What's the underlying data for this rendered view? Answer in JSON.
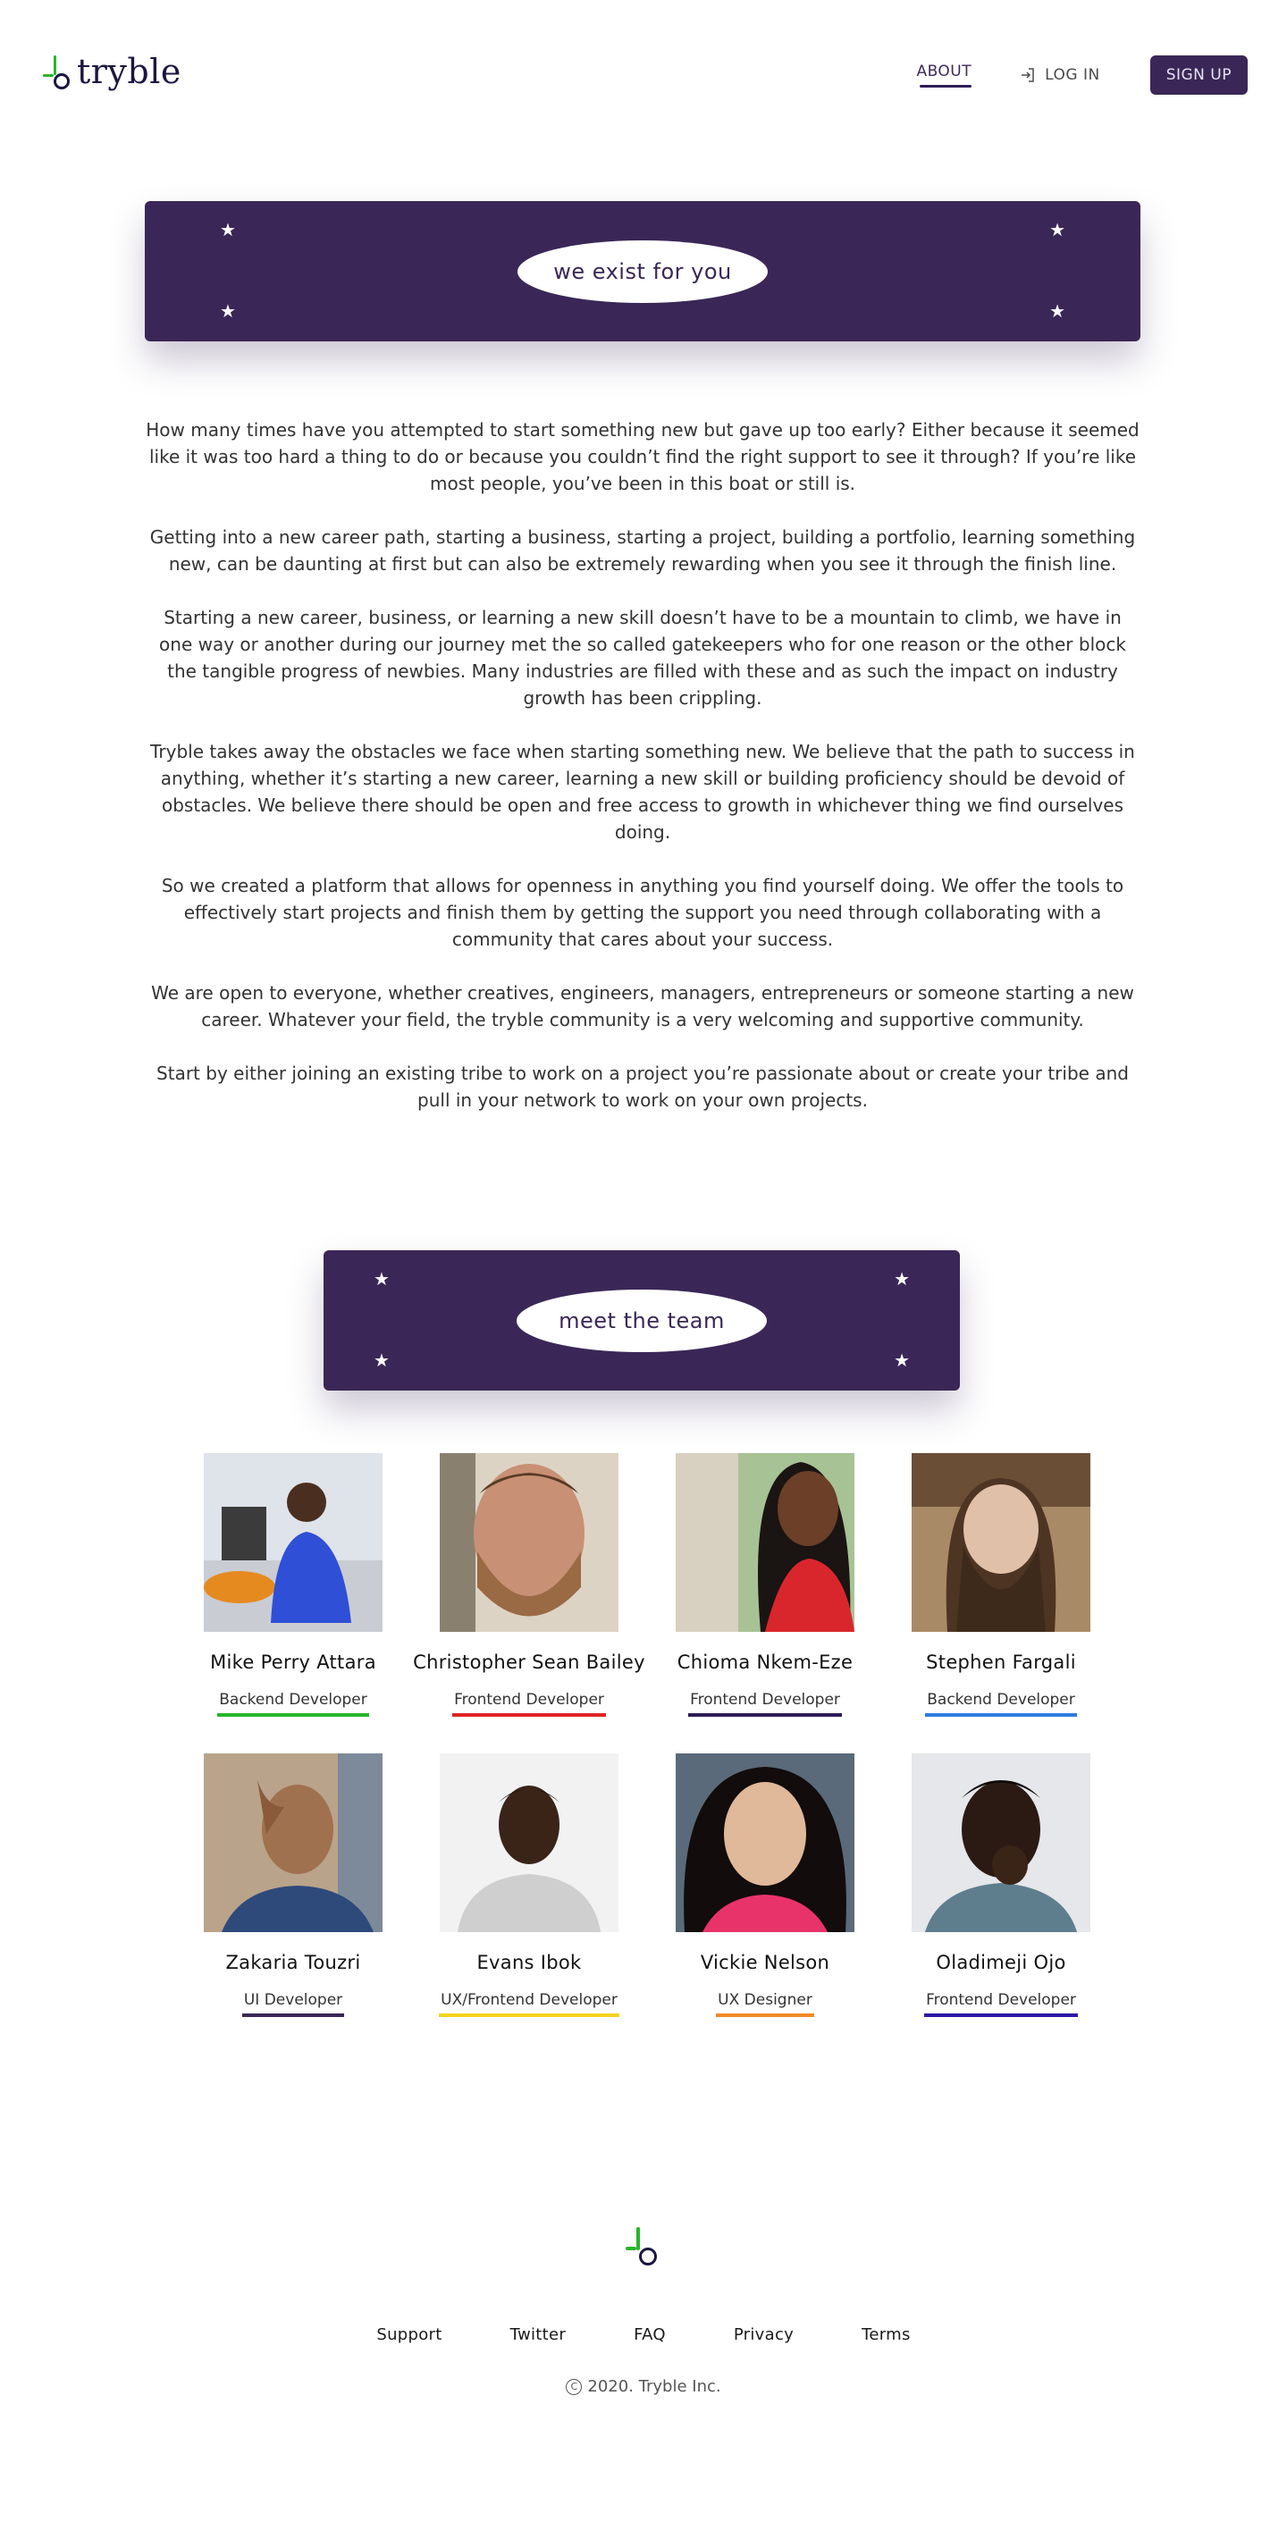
{
  "header": {
    "logo_text": "tryble",
    "nav": {
      "about": "ABOUT",
      "login": "LOG IN",
      "signup": "SIGN UP"
    }
  },
  "about_banner": {
    "title": "we exist for you"
  },
  "about": {
    "paragraphs": [
      "How many times have you attempted to start something new but gave up too early? Either because it seemed like it was too hard a thing to do or because you couldn’t find the right support to see it through? If you’re like most people, you’ve been in this boat or still is.",
      "Getting into a new career path, starting a business, starting a project, building a portfolio, learning something new, can be daunting at first but can also be extremely rewarding when you see it through the finish line.",
      "Starting a new career, business, or learning a new skill doesn’t have to be a mountain to climb, we have in one way or another during our journey met the so called gatekeepers who for one reason or the other block the tangible progress of newbies. Many industries are filled with these and as such the impact on industry growth has been crippling.",
      "Tryble takes away the obstacles we face when starting something new. We believe that the path to success in anything, whether it’s starting a new career, learning a new skill or building proficiency should be devoid of obstacles. We believe there should be open and free access to growth in whichever thing we find ourselves doing.",
      "So we created a platform that allows for openness in anything you find yourself doing. We offer the tools to effectively start projects and finish them by getting the support you need through collaborating with a community that cares about your success.",
      "We are open to everyone, whether creatives, engineers, managers, entrepreneurs or someone starting a new career. Whatever your field, the tryble community is a very welcoming and supportive community.",
      "Start by either joining an existing tribe to work on a project you’re passionate about or create your tribe and pull in your network to work on your own projects."
    ]
  },
  "team_banner": {
    "title": "meet the team"
  },
  "team": [
    {
      "name": "Mike Perry Attara",
      "role": "Backend Developer",
      "accent": "#27b52a"
    },
    {
      "name": "Christopher Sean Bailey",
      "role": "Frontend Developer",
      "accent": "#e02424"
    },
    {
      "name": "Chioma Nkem-Eze",
      "role": "Frontend Developer",
      "accent": "#2d1d57"
    },
    {
      "name": "Stephen Fargali",
      "role": "Backend Developer",
      "accent": "#2f7de1"
    },
    {
      "name": "Zakaria Touzri",
      "role": "UI Developer",
      "accent": "#3a2757"
    },
    {
      "name": "Evans Ibok",
      "role": "UX/Frontend Developer",
      "accent": "#f2d21b"
    },
    {
      "name": "Vickie Nelson",
      "role": "UX Designer",
      "accent": "#f08a24"
    },
    {
      "name": "Oladimeji Ojo",
      "role": "Frontend Developer",
      "accent": "#2a17a8"
    }
  ],
  "footer": {
    "links": [
      "Support",
      "Twitter",
      "FAQ",
      "Privacy",
      "Terms"
    ],
    "copyright": "2020. Tryble Inc."
  },
  "colors": {
    "brand_purple": "#3a2757",
    "brand_green": "#27b52a"
  }
}
